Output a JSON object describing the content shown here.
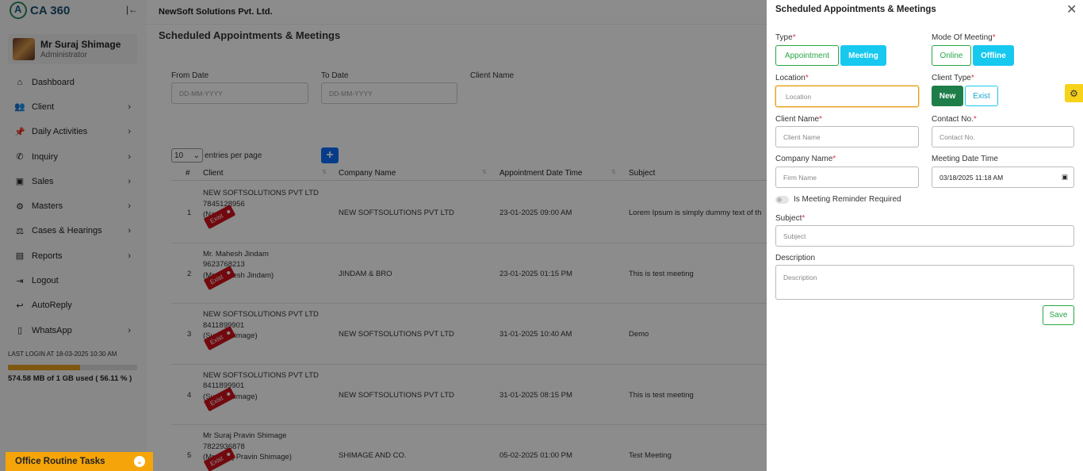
{
  "sidebar": {
    "logo_text": "CA 360",
    "collapse_icon": "collapse-left-icon",
    "user": {
      "name": "Mr Suraj Shimage",
      "role": "Administrator"
    },
    "items": [
      {
        "label": "Dashboard",
        "icon": "⌂",
        "chevron": false
      },
      {
        "label": "Client",
        "icon": "👥",
        "chevron": true
      },
      {
        "label": "Daily Activities",
        "icon": "📌",
        "chevron": true
      },
      {
        "label": "Inquiry",
        "icon": "✆",
        "chevron": true
      },
      {
        "label": "Sales",
        "icon": "▣",
        "chevron": true
      },
      {
        "label": "Masters",
        "icon": "⚙",
        "chevron": true
      },
      {
        "label": "Cases & Hearings",
        "icon": "⚖",
        "chevron": true
      },
      {
        "label": "Reports",
        "icon": "▤",
        "chevron": true
      },
      {
        "label": "Logout",
        "icon": "⇥",
        "chevron": false
      },
      {
        "label": "AutoReply",
        "icon": "↩",
        "chevron": false
      },
      {
        "label": "WhatsApp",
        "icon": "▯",
        "chevron": true
      }
    ],
    "last_login": "LAST LOGIN AT 18-03-2025 10:30 AM",
    "storage_text": "574.58 MB of 1 GB used ( 56.11 % )",
    "storage_percent": 56.11,
    "routine_label": "Office Routine Tasks"
  },
  "topbar": {
    "company": "NewSoft Solutions Pvt. Ltd."
  },
  "page": {
    "title": "Scheduled Appointments & Meetings"
  },
  "filters": {
    "from_label": "From Date",
    "from_placeholder": "DD-MM-YYYY",
    "to_label": "To Date",
    "to_placeholder": "DD-MM-YYYY",
    "client_label": "Client Name"
  },
  "table": {
    "entries_value": "10",
    "entries_label": "entries per page",
    "add_label": "+",
    "headers": {
      "num": "#",
      "client": "Client",
      "company": "Company Name",
      "date": "Appointment Date Time",
      "subject": "Subject"
    },
    "rows": [
      {
        "num": "1",
        "client_name": "NEW SOFTSOLUTIONS PVT LTD",
        "phone": "7845128956",
        "contact": "(Nandin",
        "tag": "Exist",
        "company": "NEW SOFTSOLUTIONS PVT LTD",
        "date": "23-01-2025 09:00 AM",
        "subject": "Lorem Ipsum is simply dummy text of th"
      },
      {
        "num": "2",
        "client_name": "Mr. Mahesh Jindam",
        "phone": "9623768213",
        "contact": "(Mr. Mahesh Jindam)",
        "tag": "Exist",
        "company": "JINDAM & BRO",
        "date": "23-01-2025 01:15 PM",
        "subject": "This is test meeting"
      },
      {
        "num": "3",
        "client_name": "NEW SOFTSOLUTIONS PVT LTD",
        "phone": "8411899901",
        "contact": "(Suraj Shimage)",
        "tag": "Exist",
        "company": "NEW SOFTSOLUTIONS PVT LTD",
        "date": "31-01-2025 10:40 AM",
        "subject": "Demo"
      },
      {
        "num": "4",
        "client_name": "NEW SOFTSOLUTIONS PVT LTD",
        "phone": "8411899901",
        "contact": "(Suraj Shimage)",
        "tag": "Exist",
        "company": "NEW SOFTSOLUTIONS PVT LTD",
        "date": "31-01-2025 08:15 PM",
        "subject": "This is test meeting"
      },
      {
        "num": "5",
        "client_name": "Mr Suraj Pravin Shimage",
        "phone": "7822936878",
        "contact": "(Mr Suraj Pravin Shimage)",
        "tag": "Exist",
        "company": "SHIMAGE AND CO.",
        "date": "05-02-2025 01:00 PM",
        "subject": "Test Meeting"
      }
    ]
  },
  "panel": {
    "title": "Scheduled Appointments & Meetings",
    "type_label": "Type",
    "type_options": [
      "Appointment",
      "Meeting"
    ],
    "mode_label": "Mode Of Meeting",
    "mode_options": [
      "Online",
      "Offline"
    ],
    "location_label": "Location",
    "location_placeholder": "Location",
    "client_type_label": "Client Type",
    "client_type_options": [
      "New",
      "Exist"
    ],
    "client_name_label": "Client Name",
    "client_name_placeholder": "Client Name",
    "contact_label": "Contact No.",
    "contact_placeholder": "Contact No.",
    "company_label": "Company Name",
    "company_placeholder": "Firm Name",
    "meeting_dt_label": "Meeting Date Time",
    "meeting_dt_value": "03/18/2025 11:18 AM",
    "reminder_label": "Is Meeting Reminder Required",
    "subject_label": "Subject",
    "subject_placeholder": "Subject",
    "description_label": "Description",
    "description_placeholder": "Description",
    "save_label": "Save",
    "required_mark": "*"
  },
  "colors": {
    "accent_cyan": "#17c8ef",
    "accent_green": "#28a745",
    "routine_orange": "#f5a50a",
    "tag_red": "#d0121b"
  }
}
